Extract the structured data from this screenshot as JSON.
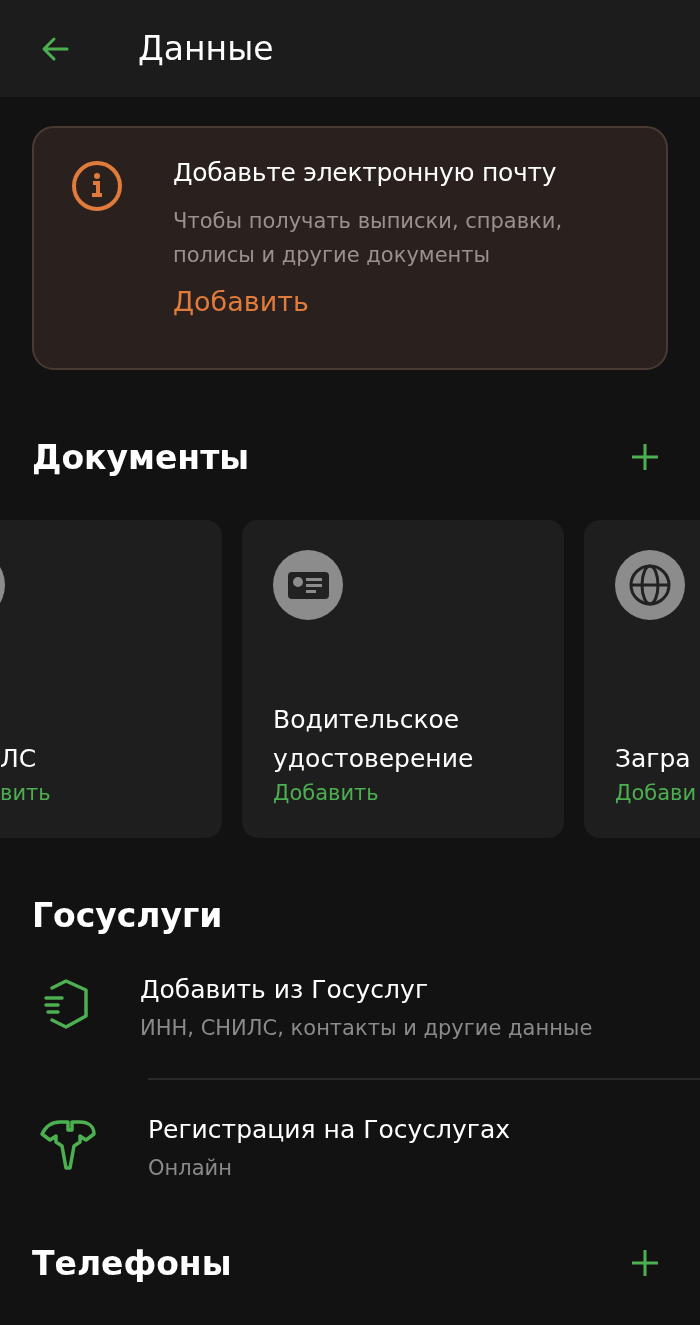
{
  "header": {
    "title": "Данные"
  },
  "banner": {
    "title": "Добавьте электронную почту",
    "text": "Чтобы получать выписки, справки, полисы и другие документы",
    "action": "Добавить"
  },
  "documents": {
    "title": "Документы",
    "cards": [
      {
        "kind": "left",
        "title": "ЛС",
        "action": "вить"
      },
      {
        "kind": "license",
        "title": "Водительское удостоверение",
        "action": "Добавить"
      },
      {
        "kind": "globe",
        "title": "Загра",
        "action": "Добави"
      }
    ]
  },
  "gosuslugi": {
    "title": "Госуслуги",
    "items": [
      {
        "kind": "hexagon",
        "title": "Добавить из Госуслуг",
        "subtitle": "ИНН, СНИЛС, контакты и другие данные"
      },
      {
        "kind": "emblem",
        "title": "Регистрация на Госуслугах",
        "subtitle": "Онлайн"
      }
    ]
  },
  "phones": {
    "title": "Телефоны"
  }
}
